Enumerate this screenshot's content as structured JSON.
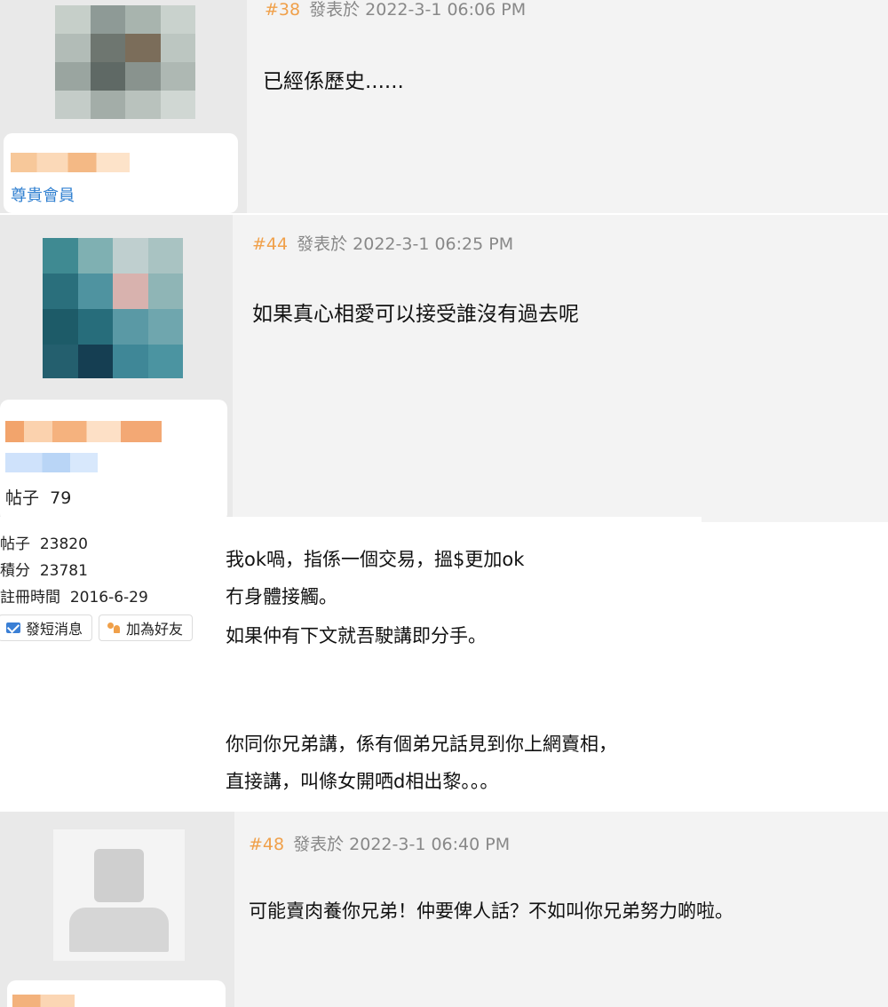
{
  "posts": [
    {
      "number": "#38",
      "posted_label": "發表於",
      "timestamp": "2022-3-1 06:06 PM",
      "body": "已經係歷史......",
      "rank": "尊貴會員"
    },
    {
      "number": "#44",
      "posted_label": "發表於",
      "timestamp": "2022-3-1 06:25 PM",
      "body": "如果真心相愛可以接受誰沒有過去呢",
      "posts_label": "帖子",
      "posts_count": "79"
    },
    {
      "number": "#48",
      "posted_label": "發表於",
      "timestamp": "2022-3-1 06:40 PM",
      "body": "可能賣肉養你兄弟！仲要俾人話？不如叫你兄弟努力啲啦。"
    }
  ],
  "quoted_post": {
    "stats": [
      {
        "label": "帖子",
        "value": "23820"
      },
      {
        "label": "積分",
        "value": "23781"
      },
      {
        "label": "註冊時間",
        "value": "2016-6-29"
      }
    ],
    "buttons": {
      "message": "發短消息",
      "add_friend": "加為好友"
    },
    "lines": [
      "我ok喎，指係一個交易，搵$更加ok",
      "冇身體接觸。",
      "如果仲有下文就吾駛講即分手。",
      "你同你兄弟講，係有個弟兄話見到你上網賣相，",
      "直接講，叫條女開哂d相出黎。。。"
    ]
  },
  "colors": {
    "post_number": "#f0a04a",
    "rank": "#2f7fd0",
    "meta": "#888888"
  },
  "icons": [
    "envelope-icon",
    "add-friend-icon"
  ]
}
